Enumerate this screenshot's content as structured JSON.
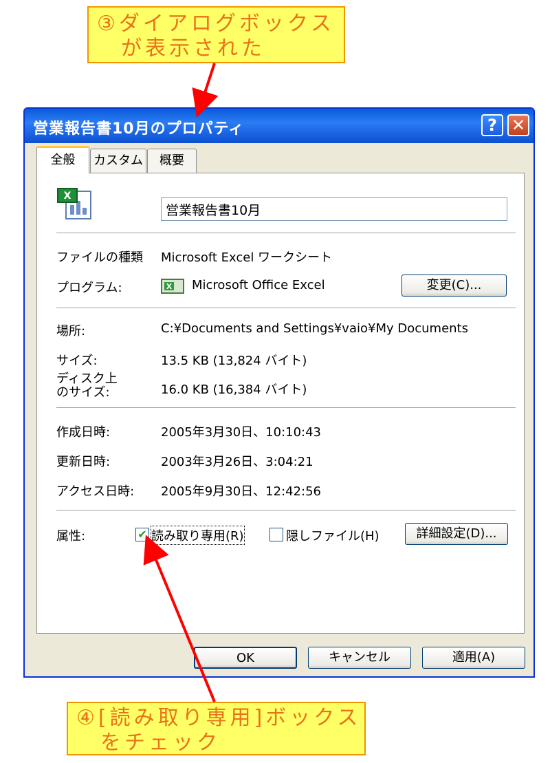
{
  "callouts": {
    "top_line1": "③ダイアログボックス",
    "top_line2": "が表示された",
    "bottom_line1": "④[読み取り専用]ボックス",
    "bottom_line2": "をチェック"
  },
  "window": {
    "title": "営業報告書10月のプロパティ",
    "help_icon": "?",
    "close_icon": "✕"
  },
  "tabs": [
    {
      "label": "全般",
      "active": true
    },
    {
      "label": "カスタム",
      "active": false
    },
    {
      "label": "概要",
      "active": false
    }
  ],
  "general": {
    "file_name": "営業報告書10月",
    "file_type_label": "ファイルの種類",
    "file_type_value": "Microsoft Excel ワークシート",
    "program_label": "プログラム:",
    "program_value": "Microsoft Office Excel",
    "change_button": "変更(C)...",
    "location_label": "場所:",
    "location_value": "C:¥Documents and Settings¥vaio¥My Documents",
    "size_label": "サイズ:",
    "size_value": "13.5 KB (13,824 バイト)",
    "disk_size_label_1": "ディスク上",
    "disk_size_label_2": "のサイズ:",
    "disk_size_value": "16.0 KB (16,384 バイト)",
    "created_label": "作成日時:",
    "created_value": "2005年3月30日、10:10:43",
    "modified_label": "更新日時:",
    "modified_value": "2003年3月26日、3:04:21",
    "accessed_label": "アクセス日時:",
    "accessed_value": "2005年9月30日、12:42:56",
    "attributes_label": "属性:",
    "readonly_label": "読み取り専用(R)",
    "readonly_checked": true,
    "hidden_label": "隠しファイル(H)",
    "hidden_checked": false,
    "advanced_button": "詳細設定(D)..."
  },
  "footer": {
    "ok": "OK",
    "cancel": "キャンセル",
    "apply": "適用(A)"
  },
  "colors": {
    "callout_bg": "#ffff66",
    "callout_text": "#e8731a",
    "arrow": "#ff0000",
    "titlebar": "#0a5bd8"
  }
}
